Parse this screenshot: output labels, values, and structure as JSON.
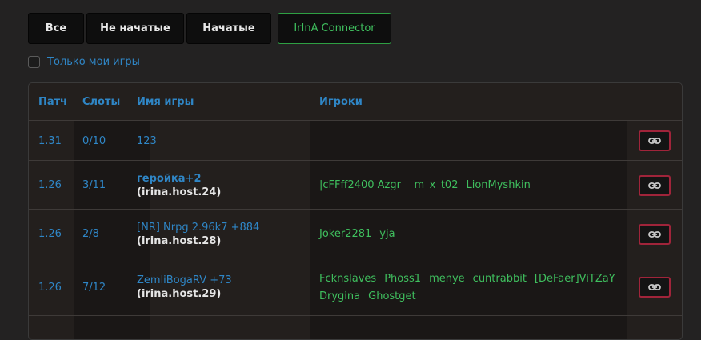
{
  "tabs": [
    {
      "label": "Все"
    },
    {
      "label": "Не начатые"
    },
    {
      "label": "Начатые"
    },
    {
      "label": "IrInA Connector"
    }
  ],
  "filter": {
    "label": "Только мои игры",
    "checked": false
  },
  "table": {
    "headers": {
      "patch": "Патч",
      "slots": "Слоты",
      "name": "Имя игры",
      "players": "Игроки"
    },
    "rows": [
      {
        "patch": "1.31",
        "slots": "0/10",
        "name": "123",
        "host": "",
        "players": []
      },
      {
        "patch": "1.26",
        "slots": "3/11",
        "name": "геройка+2",
        "host": "(irina.host.24)",
        "players": [
          "|cFFff2400 Azgr",
          "_m_x_t02",
          "LionMyshkin"
        ]
      },
      {
        "patch": "1.26",
        "slots": "2/8",
        "name": "[NR] Nrpg 2.96k7 +884",
        "host": "(irina.host.28)",
        "players": [
          "Joker2281",
          "yja"
        ]
      },
      {
        "patch": "1.26",
        "slots": "7/12",
        "name": "ZemliBogaRV +73",
        "host": "(irina.host.29)",
        "players": [
          "Fcknslaves",
          "Phoss1",
          "menye",
          "cuntrabbit",
          "[DeFaer]ViTZaY",
          "Drygina",
          "Ghostget"
        ]
      }
    ]
  },
  "icons": {
    "join": "link-icon"
  },
  "colors": {
    "accent_blue": "#2f86c6",
    "accent_green": "#3fbf5e",
    "join_border": "#a0243a"
  }
}
